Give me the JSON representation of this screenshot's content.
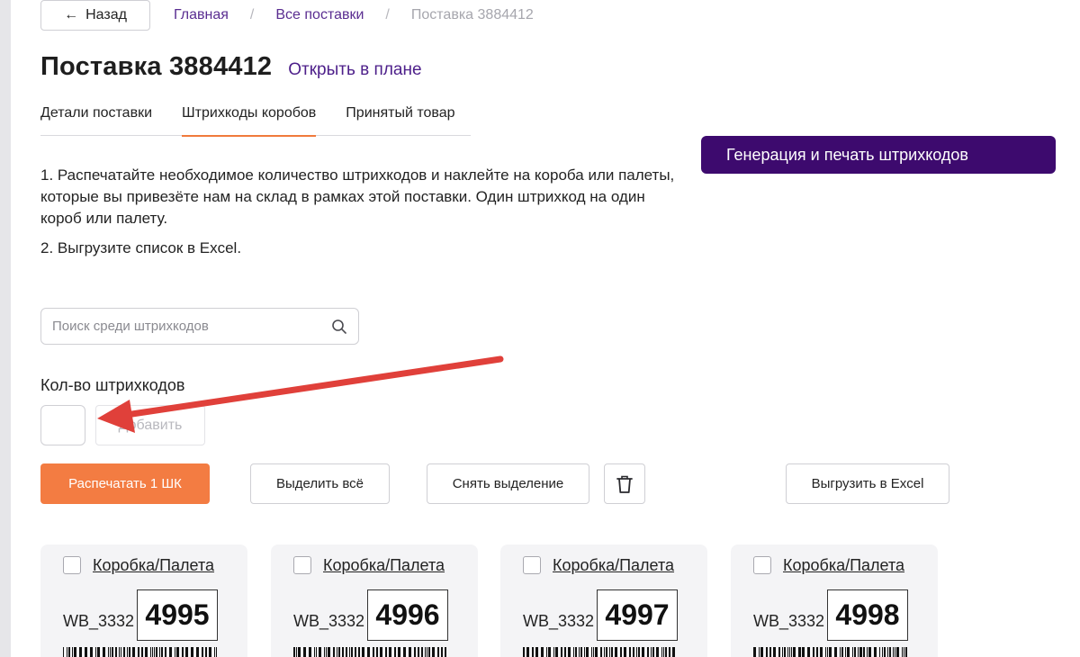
{
  "nav": {
    "back_label": "Назад",
    "breadcrumbs": [
      "Главная",
      "Все поставки",
      "Поставка 3884412"
    ]
  },
  "header": {
    "title": "Поставка 3884412",
    "open_in_plan": "Открыть в плане"
  },
  "tabs": [
    "Детали поставки",
    "Штрихкоды коробов",
    "Принятый товар"
  ],
  "active_tab": "Штрихкоды коробов",
  "generate_button": "Генерация и печать штрихкодов",
  "instructions": [
    "1. Распечатайте необходимое количество штрихкодов и наклейте на короба или палеты, которые вы привезёте нам на склад в рамках этой поставки. Один штрихкод на один короб или палету.",
    "2. Выгрузите список в Excel."
  ],
  "search": {
    "placeholder": "Поиск среди штрихкодов",
    "value": ""
  },
  "count": {
    "label": "Кол-во штрихкодов",
    "value": "",
    "add_label": "Добавить"
  },
  "actions": {
    "print_label": "Распечатать 1 ШК",
    "select_all_label": "Выделить всё",
    "deselect_label": "Снять выделение",
    "export_label": "Выгрузить в Excel"
  },
  "cards": [
    {
      "type": "Коробка/Палета",
      "prefix": "WB_3332",
      "number": "4995",
      "checked": false
    },
    {
      "type": "Коробка/Палета",
      "prefix": "WB_3332",
      "number": "4996",
      "checked": false
    },
    {
      "type": "Коробка/Палета",
      "prefix": "WB_3332",
      "number": "4997",
      "checked": false
    },
    {
      "type": "Коробка/Палета",
      "prefix": "WB_3332",
      "number": "4998",
      "checked": false
    }
  ],
  "colors": {
    "accent_purple": "#3d0a6e",
    "link_purple": "#4d1f8a",
    "accent_orange": "#f37c42",
    "annotation_red": "#e0403a"
  },
  "icons": [
    "arrow-left-icon",
    "search-icon",
    "trash-icon",
    "annotation-arrow"
  ]
}
